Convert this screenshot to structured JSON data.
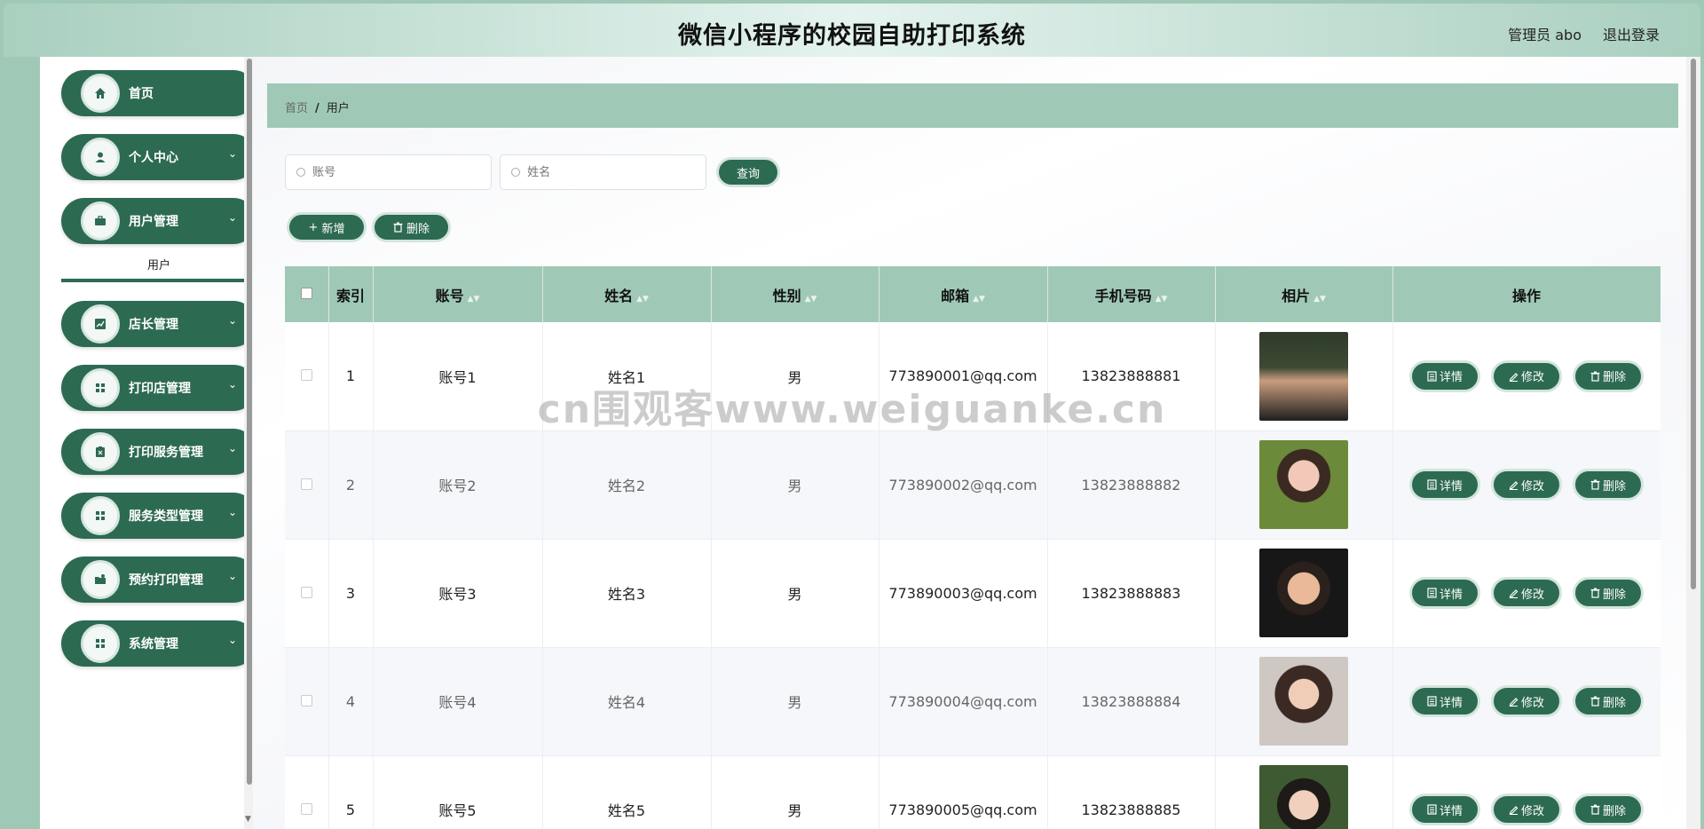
{
  "header": {
    "title": "微信小程序的校园自助打印系统",
    "admin_label": "管理员 abo",
    "logout_label": "退出登录"
  },
  "sidebar": {
    "items": [
      {
        "label": "首页",
        "icon": "home-icon",
        "has_chevron": false
      },
      {
        "label": "个人中心",
        "icon": "user-icon",
        "has_chevron": true
      },
      {
        "label": "用户管理",
        "icon": "briefcase-icon",
        "has_chevron": true
      },
      {
        "label": "店长管理",
        "icon": "chart-icon",
        "has_chevron": true
      },
      {
        "label": "打印店管理",
        "icon": "grid-icon",
        "has_chevron": true
      },
      {
        "label": "打印服务管理",
        "icon": "clipboard-icon",
        "has_chevron": true
      },
      {
        "label": "服务类型管理",
        "icon": "grid-icon",
        "has_chevron": true
      },
      {
        "label": "预约打印管理",
        "icon": "folder-icon",
        "has_chevron": true
      },
      {
        "label": "系统管理",
        "icon": "grid-icon",
        "has_chevron": true
      }
    ],
    "submenu": {
      "label": "用户"
    }
  },
  "breadcrumb": {
    "home": "首页",
    "separator": "/",
    "current": "用户"
  },
  "search": {
    "account_placeholder": "账号",
    "name_placeholder": "姓名",
    "query_label": "查询"
  },
  "actions": {
    "add_label": "新增",
    "delete_label": "删除"
  },
  "table": {
    "headers": {
      "index": "索引",
      "account": "账号",
      "name": "姓名",
      "gender": "性别",
      "email": "邮箱",
      "phone": "手机号码",
      "photo": "相片",
      "ops": "操作"
    },
    "rows": [
      {
        "index": "1",
        "account": "账号1",
        "name": "姓名1",
        "gender": "男",
        "email": "773890001@qq.com",
        "phone": "13823888881"
      },
      {
        "index": "2",
        "account": "账号2",
        "name": "姓名2",
        "gender": "男",
        "email": "773890002@qq.com",
        "phone": "13823888882"
      },
      {
        "index": "3",
        "account": "账号3",
        "name": "姓名3",
        "gender": "男",
        "email": "773890003@qq.com",
        "phone": "13823888883"
      },
      {
        "index": "4",
        "account": "账号4",
        "name": "姓名4",
        "gender": "男",
        "email": "773890004@qq.com",
        "phone": "13823888884"
      },
      {
        "index": "5",
        "account": "账号5",
        "name": "姓名5",
        "gender": "男",
        "email": "773890005@qq.com",
        "phone": "13823888885"
      }
    ],
    "op_labels": {
      "detail": "详情",
      "edit": "修改",
      "delete": "删除"
    }
  },
  "watermark": "cn围观客www.weiguanke.cn",
  "colors": {
    "primary": "#2d6a52",
    "accent_light": "#9fc9b6"
  }
}
